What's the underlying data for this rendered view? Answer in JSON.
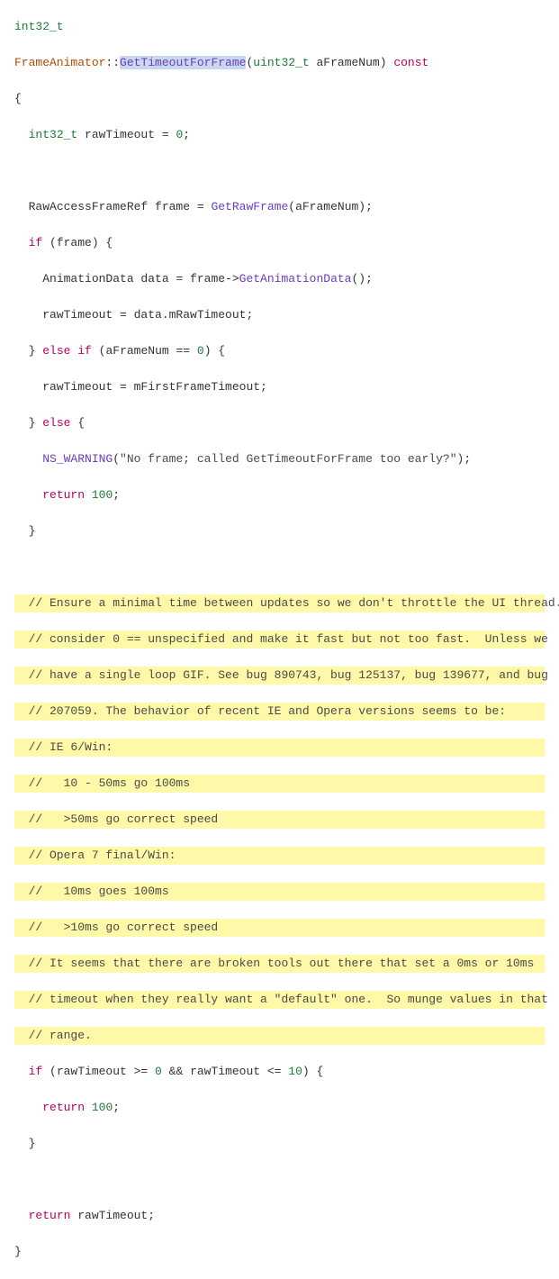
{
  "code": {
    "l1_type": "int32_t",
    "l2_class": "FrameAnimator",
    "l2_scope": "::",
    "l2_func": "GetTimeoutForFrame",
    "l2_paren_open": "(",
    "l2_param_type": "uint32_t",
    "l2_param_name": " aFrameNum",
    "l2_paren_close": ") ",
    "l2_const": "const",
    "l3": "{",
    "l4_indent": "  ",
    "l4_type": "int32_t",
    "l4_rest": " rawTimeout = ",
    "l4_num": "0",
    "l4_semi": ";",
    "l6_indent": "  ",
    "l6_a": "RawAccessFrameRef frame = ",
    "l6_func": "GetRawFrame",
    "l6_b": "(aFrameNum);",
    "l7_indent": "  ",
    "l7_if": "if",
    "l7_rest": " (frame) {",
    "l8_indent": "    ",
    "l8_a": "AnimationData data = frame->",
    "l8_func": "GetAnimationData",
    "l8_b": "();",
    "l9": "    rawTimeout = data.mRawTimeout;",
    "l10_indent": "  } ",
    "l10_else": "else",
    "l10_sp": " ",
    "l10_if": "if",
    "l10_a": " (aFrameNum == ",
    "l10_num": "0",
    "l10_b": ") {",
    "l11": "    rawTimeout = mFirstFrameTimeout;",
    "l12_indent": "  } ",
    "l12_else": "else",
    "l12_rest": " {",
    "l13_indent": "    ",
    "l13_func": "NS_WARNING",
    "l13_a": "(",
    "l13_str": "\"No frame; called GetTimeoutForFrame too early?\"",
    "l13_b": ");",
    "l14_indent": "    ",
    "l14_ret": "return",
    "l14_sp": " ",
    "l14_num": "100",
    "l14_semi": ";",
    "l15": "  }",
    "c1": "  // Ensure a minimal time between updates so we don't throttle the UI thread.",
    "c2": "  // consider 0 == unspecified and make it fast but not too fast.  Unless we",
    "c3": "  // have a single loop GIF. See bug 890743, bug 125137, bug 139677, and bug",
    "c4": "  // 207059. The behavior of recent IE and Opera versions seems to be:",
    "c5": "  // IE 6/Win:",
    "c6": "  //   10 - 50ms go 100ms",
    "c7": "  //   >50ms go correct speed",
    "c8": "  // Opera 7 final/Win:",
    "c9": "  //   10ms goes 100ms",
    "c10": "  //   >10ms go correct speed",
    "c11": "  // It seems that there are broken tools out there that set a 0ms or 10ms",
    "c12": "  // timeout when they really want a \"default\" one.  So munge values in that",
    "c13": "  // range.",
    "l30_indent": "  ",
    "l30_if": "if",
    "l30_a": " (rawTimeout >= ",
    "l30_n1": "0",
    "l30_b": " && rawTimeout <= ",
    "l30_n2": "10",
    "l30_c": ") {",
    "l31_indent": "    ",
    "l31_ret": "return",
    "l31_sp": " ",
    "l31_num": "100",
    "l31_semi": ";",
    "l32": "  }",
    "l34_indent": "  ",
    "l34_ret": "return",
    "l34_rest": " rawTimeout;",
    "l35": "}"
  }
}
